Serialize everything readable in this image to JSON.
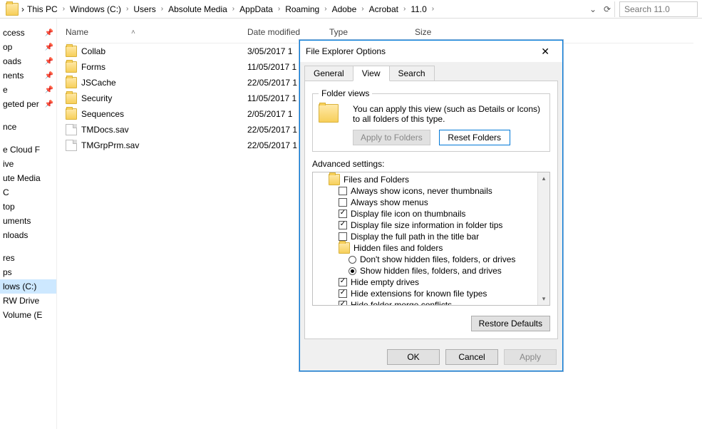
{
  "breadcrumb": [
    "This PC",
    "Windows (C:)",
    "Users",
    "Absolute Media",
    "AppData",
    "Roaming",
    "Adobe",
    "Acrobat",
    "11.0"
  ],
  "search_placeholder": "Search 11.0",
  "columns": {
    "name": "Name",
    "date": "Date modified",
    "type": "Type",
    "size": "Size"
  },
  "files": [
    {
      "name": "Collab",
      "date": "3/05/2017 1",
      "kind": "folder"
    },
    {
      "name": "Forms",
      "date": "11/05/2017 1",
      "kind": "folder"
    },
    {
      "name": "JSCache",
      "date": "22/05/2017 1",
      "kind": "folder"
    },
    {
      "name": "Security",
      "date": "11/05/2017 1",
      "kind": "folder"
    },
    {
      "name": "Sequences",
      "date": "2/05/2017 1",
      "kind": "folder"
    },
    {
      "name": "TMDocs.sav",
      "date": "22/05/2017 1",
      "kind": "file"
    },
    {
      "name": "TMGrpPrm.sav",
      "date": "22/05/2017 1",
      "kind": "file"
    }
  ],
  "nav": [
    "ccess",
    "op",
    "oads",
    "nents",
    "e",
    "geted per",
    "",
    "nce",
    "",
    "e Cloud F",
    "ive",
    "ute Media",
    "C",
    "top",
    "uments",
    "nloads",
    "",
    "res",
    "ps",
    "lows (C:)",
    "RW Drive",
    "Volume (E"
  ],
  "nav_pins": [
    0,
    1,
    2,
    3,
    4,
    5
  ],
  "nav_selected": 19,
  "dialog": {
    "title": "File Explorer Options",
    "tabs": [
      "General",
      "View",
      "Search"
    ],
    "active_tab": 1,
    "folder_views": {
      "legend": "Folder views",
      "desc": "You can apply this view (such as Details or Icons) to all folders of this type.",
      "apply": "Apply to Folders",
      "reset": "Reset Folders"
    },
    "adv_label": "Advanced settings:",
    "tree": {
      "root": "Files and Folders",
      "items": [
        {
          "type": "cb",
          "checked": false,
          "label": "Always show icons, never thumbnails",
          "indent": 2
        },
        {
          "type": "cb",
          "checked": false,
          "label": "Always show menus",
          "indent": 2
        },
        {
          "type": "cb",
          "checked": true,
          "label": "Display file icon on thumbnails",
          "indent": 2
        },
        {
          "type": "cb",
          "checked": true,
          "label": "Display file size information in folder tips",
          "indent": 2
        },
        {
          "type": "cb",
          "checked": false,
          "label": "Display the full path in the title bar",
          "indent": 2
        },
        {
          "type": "folder",
          "label": "Hidden files and folders",
          "indent": 2
        },
        {
          "type": "rb",
          "checked": false,
          "label": "Don't show hidden files, folders, or drives",
          "indent": 3
        },
        {
          "type": "rb",
          "checked": true,
          "label": "Show hidden files, folders, and drives",
          "indent": 3
        },
        {
          "type": "cb",
          "checked": true,
          "label": "Hide empty drives",
          "indent": 2
        },
        {
          "type": "cb",
          "checked": true,
          "label": "Hide extensions for known file types",
          "indent": 2
        },
        {
          "type": "cb",
          "checked": true,
          "label": "Hide folder merge conflicts",
          "indent": 2
        }
      ]
    },
    "restore": "Restore Defaults",
    "buttons": {
      "ok": "OK",
      "cancel": "Cancel",
      "apply": "Apply"
    }
  }
}
